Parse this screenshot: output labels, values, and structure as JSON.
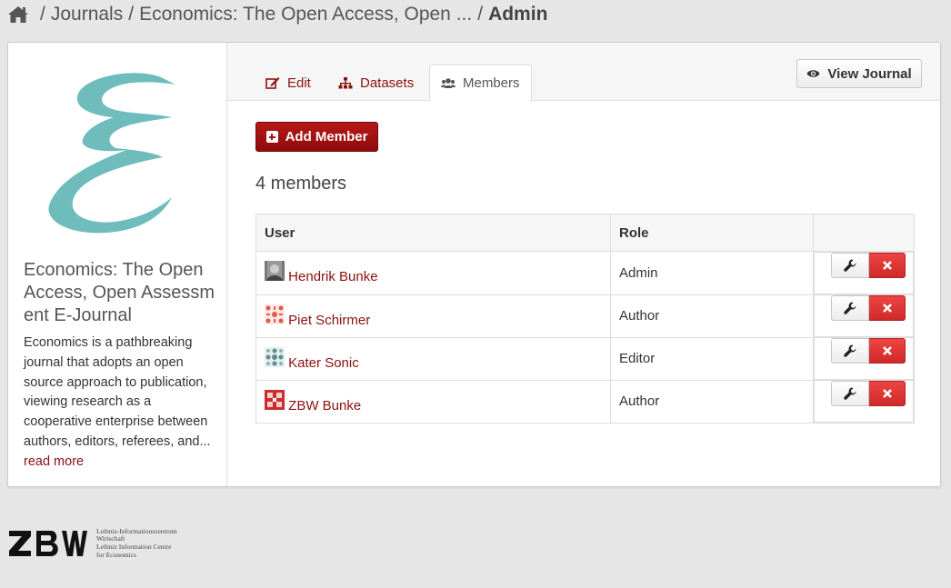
{
  "breadcrumb": {
    "items": [
      "Journals",
      "Economics: The Open Access, Open ...",
      "Admin"
    ],
    "separator": "/"
  },
  "journal": {
    "title": "Economics: The Open Access, Open Assessment E-Journal",
    "description": "Economics is a pathbreaking journal that adopts an open source approach to publication, viewing research as a cooperative enterprise between authors, editors, referees, and...",
    "read_more": "read more",
    "logo_color": "#6fbcbd"
  },
  "tabs": [
    {
      "label": "Edit",
      "icon": "edit-icon"
    },
    {
      "label": "Datasets",
      "icon": "sitemap-icon"
    },
    {
      "label": "Members",
      "icon": "users-icon",
      "active": true
    }
  ],
  "view_journal_label": "View Journal",
  "add_member_label": "Add Member",
  "members_count": "4 members",
  "table": {
    "headers": [
      "User",
      "Role",
      ""
    ],
    "rows": [
      {
        "user": "Hendrik Bunke",
        "role": "Admin"
      },
      {
        "user": "Piet Schirmer",
        "role": "Author"
      },
      {
        "user": "Kater Sonic",
        "role": "Editor"
      },
      {
        "user": "ZBW Bunke",
        "role": "Author"
      }
    ]
  },
  "footer": {
    "logo_text": "ZBW",
    "org_lines": [
      "Leibniz-Informationszentrum",
      "Wirtschaft",
      "Leibniz Information Centre",
      "for Economics"
    ]
  },
  "colors": {
    "brand_red": "#8c1010",
    "delete_red": "#d83333"
  }
}
